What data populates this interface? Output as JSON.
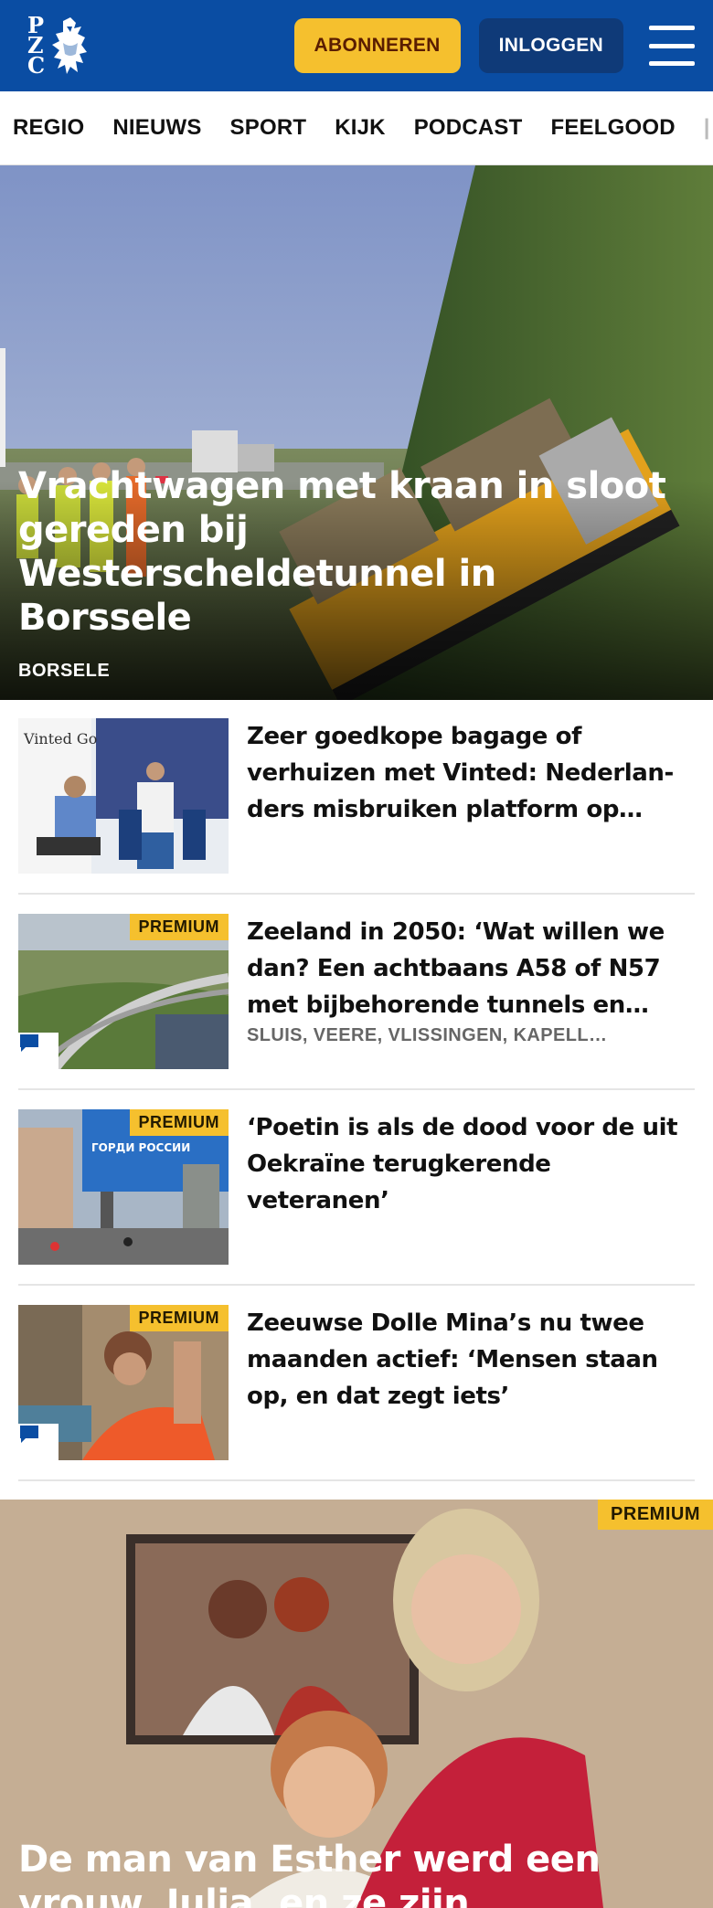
{
  "header": {
    "logo_letters": [
      "P",
      "Z",
      "C"
    ],
    "subscribe_label": "ABONNEREN",
    "login_label": "INLOGGEN"
  },
  "nav": {
    "items": [
      "REGIO",
      "NIEUWS",
      "SPORT",
      "KIJK",
      "PODCAST",
      "FEELGOOD"
    ]
  },
  "hero": {
    "title": "Vrachtwagen met kraan in sloot gereden bij Westerscheldetunnel in Borssele",
    "location": "BORSELE"
  },
  "articles": [
    {
      "title": "Zeer goedkope bagage of verhuizen met Vinted: Nederlan­ders misbruiken platform op…",
      "badge": "",
      "location": "",
      "has_comments": false,
      "thumb_text": "Vinted Go"
    },
    {
      "title": "Zeeland in 2050: ‘Wat willen we dan? Een achtbaans A58 of N57 met bijbehorende tunnels en…",
      "badge": "PREMIUM",
      "location": "SLUIS, VEERE, VLISSINGEN, KAPELL…",
      "has_comments": true,
      "thumb_text": ""
    },
    {
      "title": "‘Poetin is als de dood voor de uit Oekraïne terugkerende veteranen’",
      "badge": "PREMIUM",
      "location": "",
      "has_comments": false,
      "thumb_text": "ГОРДИ РОССИИ"
    },
    {
      "title": "Zeeuwse Dolle Mina’s nu twee maanden actief: ‘Mensen staan op, en dat zegt iets’",
      "badge": "PREMIUM",
      "location": "",
      "has_comments": true,
      "thumb_text": ""
    }
  ],
  "feature": {
    "badge": "PREMIUM",
    "title": "De man van Esther werd een vrouw, Julia, en ze zijn dolgelukkig: ‘We…"
  },
  "colors": {
    "brand_blue": "#0a4da3",
    "accent_yellow": "#f5c02e",
    "login_blue": "#0f3a78"
  }
}
